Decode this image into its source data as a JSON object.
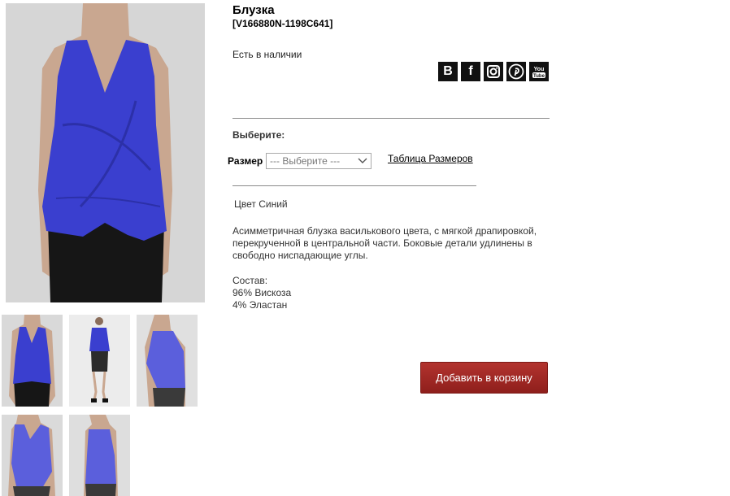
{
  "product": {
    "title": "Блузка",
    "sku": "[V166880N-1198C641]",
    "stock_status": "Есть в наличии"
  },
  "social": [
    {
      "name": "vk-icon",
      "glyph": "B"
    },
    {
      "name": "facebook-icon",
      "glyph": "f"
    },
    {
      "name": "instagram-icon",
      "glyph": ""
    },
    {
      "name": "pinterest-icon",
      "glyph": ""
    },
    {
      "name": "youtube-icon",
      "glyph": ""
    }
  ],
  "options": {
    "choose_label": "Выберите:",
    "size_label": "Размер",
    "size_select_value": "--- Выберите ---",
    "size_table_link": "Таблица Размеров"
  },
  "color_text": "Цвет Синий",
  "description": "Асимметричная блузка василькового цвета, с мягкой драпировкой, перекрученной в центральной части. Боковые детали удлинены в свободно ниспадающие углы.",
  "composition": {
    "title": "Состав:",
    "line1": "96% Вискоза",
    "line2": "4% Эластан"
  },
  "cart_button": "Добавить в корзину",
  "colors": {
    "blouse": "#3a3fcf",
    "cart_button": "#a52a27"
  }
}
